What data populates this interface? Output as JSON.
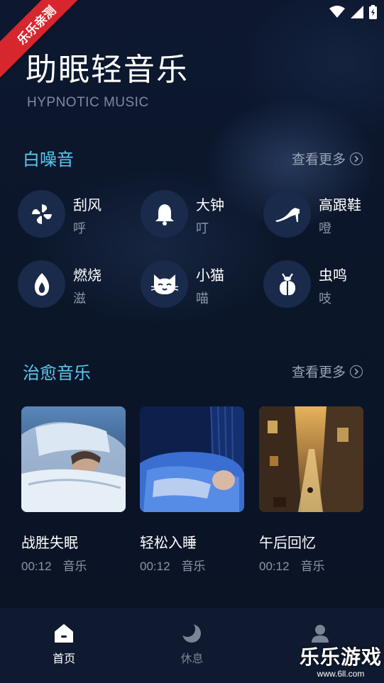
{
  "status": {
    "icons": [
      "wifi-icon",
      "signal-icon",
      "battery-charging-icon"
    ]
  },
  "ribbon": {
    "label": "乐乐亲测"
  },
  "header": {
    "title": "助眠轻音乐",
    "subtitle": "HYPNOTIC MUSIC"
  },
  "white_noise": {
    "title": "白噪音",
    "see_more": "查看更多",
    "items": [
      {
        "name": "刮风",
        "sound": "呼",
        "icon": "fan-icon"
      },
      {
        "name": "大钟",
        "sound": "叮",
        "icon": "bell-icon"
      },
      {
        "name": "高跟鞋",
        "sound": "噔",
        "icon": "high-heel-icon"
      },
      {
        "name": "燃烧",
        "sound": "滋",
        "icon": "flame-icon"
      },
      {
        "name": "小猫",
        "sound": "喵",
        "icon": "cat-icon"
      },
      {
        "name": "虫鸣",
        "sound": "吱",
        "icon": "insect-icon"
      }
    ]
  },
  "healing_music": {
    "title": "治愈音乐",
    "see_more": "查看更多",
    "cards": [
      {
        "title": "战胜失眠",
        "duration": "00:12",
        "type": "音乐"
      },
      {
        "title": "轻松入睡",
        "duration": "00:12",
        "type": "音乐"
      },
      {
        "title": "午后回忆",
        "duration": "00:12",
        "type": "音乐"
      }
    ]
  },
  "tabs": [
    {
      "label": "首页",
      "icon": "home-icon",
      "active": true
    },
    {
      "label": "休息",
      "icon": "moon-icon",
      "active": false
    },
    {
      "label": "",
      "icon": "user-icon",
      "active": false
    }
  ],
  "watermark": {
    "big": "乐乐游戏",
    "small": "www.6ll.com"
  },
  "colors": {
    "accent": "#5cc8f0",
    "background": "#0a1324",
    "icon_circle": "#1a2a4a"
  }
}
